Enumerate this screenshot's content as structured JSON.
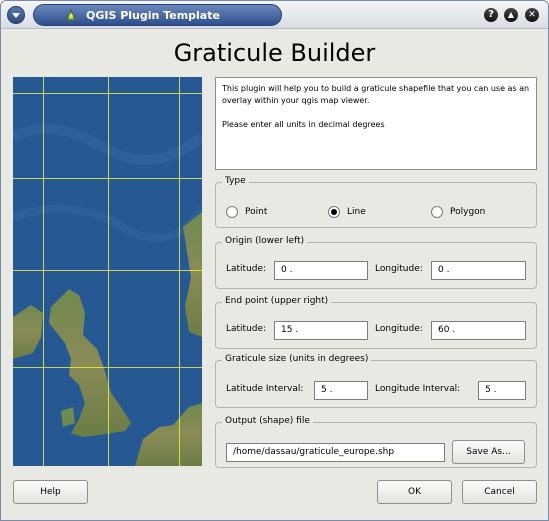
{
  "window": {
    "title": "QGIS Plugin Template",
    "controls": {
      "help": "?",
      "shade": "▲",
      "close": "✕"
    }
  },
  "heading": "Graticule Builder",
  "description": {
    "line1": "This plugin will help you to build a graticule shapefile that you can use as an overlay within your qgis map viewer.",
    "line2": "Please enter all units in decimal degrees"
  },
  "type_group": {
    "title": "Type",
    "options": [
      {
        "label": "Point",
        "selected": false
      },
      {
        "label": "Line",
        "selected": true
      },
      {
        "label": "Polygon",
        "selected": false
      }
    ]
  },
  "origin": {
    "title": "Origin (lower left)",
    "latitude_label": "Latitude:",
    "latitude_value": "0  .",
    "longitude_label": "Longitude:",
    "longitude_value": "0  ."
  },
  "end_point": {
    "title": "End point (upper right)",
    "latitude_label": "Latitude:",
    "latitude_value": "15  .",
    "longitude_label": "Longitude:",
    "longitude_value": "60  ."
  },
  "graticule_size": {
    "title": "Graticule size (units in degrees)",
    "lat_interval_label": "Latitude Interval:",
    "lat_interval_value": "5  .",
    "lon_interval_label": "Longitude Interval:",
    "lon_interval_value": "5  ."
  },
  "output": {
    "title": "Output (shape) file",
    "path": "/home/dassau/graticule_europe.shp",
    "save_as_label": "Save As..."
  },
  "footer": {
    "help_label": "Help",
    "ok_label": "OK",
    "cancel_label": "Cancel"
  },
  "colors": {
    "title_bar": "#2e4f8d",
    "window_bg": "#e9e9e4",
    "grid_lines": "#e8ee45",
    "sea": "#285995"
  },
  "icons": [
    "window-menu-icon",
    "qgis-logo-icon",
    "help-icon",
    "shade-icon",
    "close-icon",
    "europe-map-image"
  ]
}
